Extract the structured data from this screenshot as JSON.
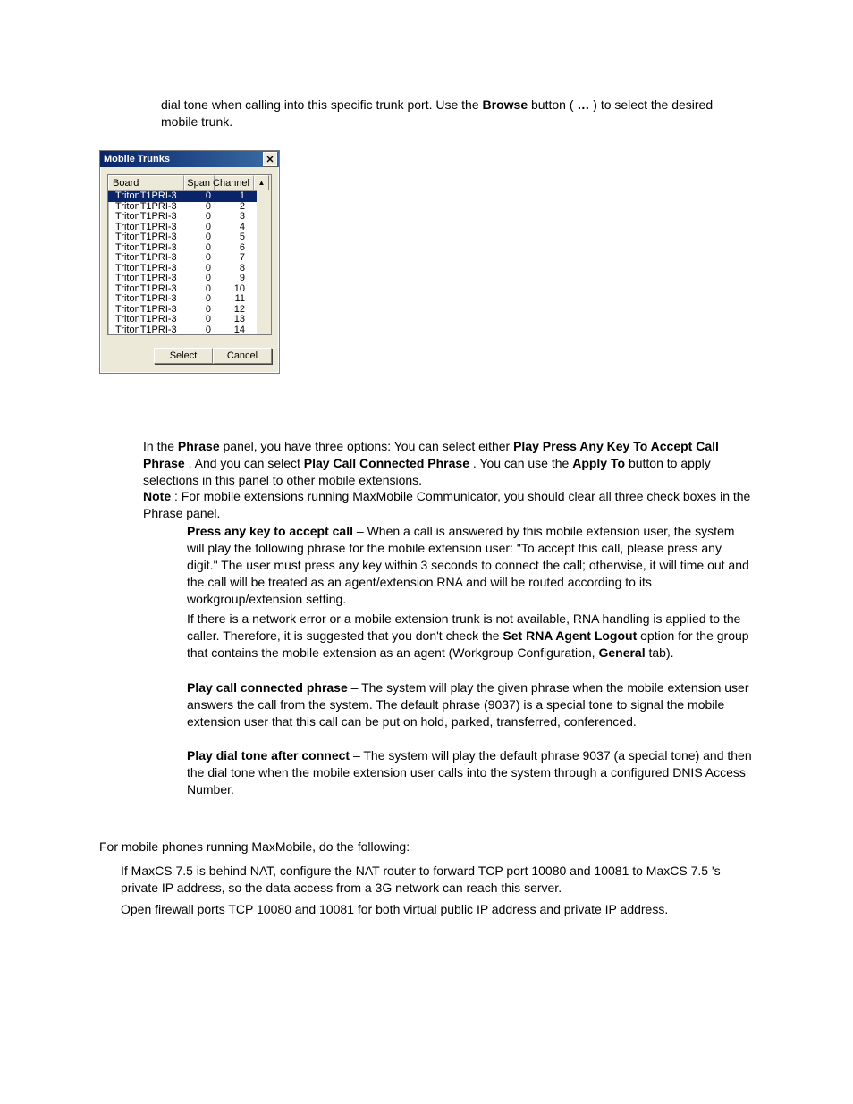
{
  "p_top1_a": "dial tone when calling into this specific trunk port. Use the ",
  "p_top1_b": "Browse",
  "p_top1_c": " button ( ",
  "p_top1_d": "…",
  "p_top1_e": " ) to select the desired mobile trunk.",
  "dialog": {
    "title": "Mobile Trunks",
    "headers": {
      "board": "Board",
      "span": "Span",
      "channel": "Channel"
    },
    "rows": [
      {
        "board": "TritonT1PRI-3",
        "span": "0",
        "channel": "1",
        "selected": true
      },
      {
        "board": "TritonT1PRI-3",
        "span": "0",
        "channel": "2"
      },
      {
        "board": "TritonT1PRI-3",
        "span": "0",
        "channel": "3"
      },
      {
        "board": "TritonT1PRI-3",
        "span": "0",
        "channel": "4"
      },
      {
        "board": "TritonT1PRI-3",
        "span": "0",
        "channel": "5"
      },
      {
        "board": "TritonT1PRI-3",
        "span": "0",
        "channel": "6"
      },
      {
        "board": "TritonT1PRI-3",
        "span": "0",
        "channel": "7"
      },
      {
        "board": "TritonT1PRI-3",
        "span": "0",
        "channel": "8"
      },
      {
        "board": "TritonT1PRI-3",
        "span": "0",
        "channel": "9"
      },
      {
        "board": "TritonT1PRI-3",
        "span": "0",
        "channel": "10"
      },
      {
        "board": "TritonT1PRI-3",
        "span": "0",
        "channel": "11"
      },
      {
        "board": "TritonT1PRI-3",
        "span": "0",
        "channel": "12"
      },
      {
        "board": "TritonT1PRI-3",
        "span": "0",
        "channel": "13"
      },
      {
        "board": "TritonT1PRI-3",
        "span": "0",
        "channel": "14"
      }
    ],
    "select_btn": "Select",
    "cancel_btn": "Cancel"
  },
  "para2_a": "In the ",
  "para2_b": "Phrase",
  "para2_c": " panel, you have three options: You can select either ",
  "para2_d": "Play Press Any Key To Accept Call Phrase",
  "para2_e": ". And you can select ",
  "para2_f": "Play Call Connected Phrase",
  "para2_g": ". You can use the ",
  "para2_h": "Apply To",
  "para2_i": " button to apply selections in this panel to other mobile extensions.",
  "note_a": "Note",
  "note_b": ": For mobile extensions running MaxMobile Communicator, you should clear all three check boxes in the Phrase panel.",
  "p3_a": "Press any key to accept call",
  "p3_b": " – When a call is answered by this mobile extension user, the system will play the following phrase for the mobile extension user: \"To accept this call, please press any digit.\" The user must press any key within 3 seconds to connect the call; otherwise, it will time out and the call will be treated as an agent/extension RNA and will be routed according to its workgroup/extension setting.",
  "p4_a": "If there is a network error or a mobile extension trunk is not available, RNA handling is applied to the caller. Therefore, it is suggested that you don't check the ",
  "p4_b": "Set RNA Agent Logout",
  "p4_c": " option for the group that contains the mobile extension as an agent (Workgroup Configuration, ",
  "p4_d": "General",
  "p4_e": " tab).",
  "p5_a": "Play call connected phrase",
  "p5_b": " – The system will play the given phrase when the mobile extension user answers the call from the system. The default phrase (9037) is a special tone to signal the mobile extension user that this call can be put on hold, parked, transferred, conferenced.",
  "p6_a": "Play dial tone after connect",
  "p6_b": " – The system will play the default phrase 9037 (a special tone) and then the dial tone when the mobile extension user calls into the system through a configured DNIS Access Number.",
  "p7": "For mobile phones running MaxMobile, do the following:",
  "p8": "If MaxCS 7.5  is behind NAT, configure the NAT router to forward TCP port 10080 and 10081 to MaxCS 7.5 's private IP address, so the data access from a 3G network can reach this server.",
  "p9": "Open firewall ports TCP 10080 and 10081 for both virtual public IP address and private IP address."
}
